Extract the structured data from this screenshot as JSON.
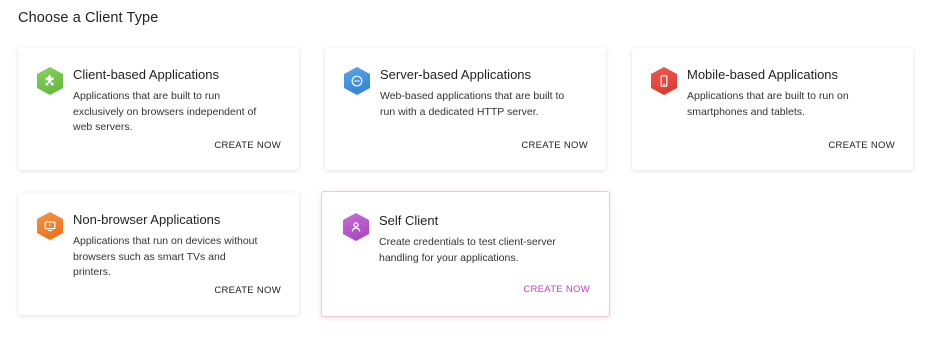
{
  "page": {
    "title": "Choose a Client Type"
  },
  "cards": [
    {
      "title": "Client-based Applications",
      "description": "Applications that are built to run exclusively on browsers independent of web servers.",
      "cta": "CREATE NOW",
      "icon": "puzzle-icon",
      "color": "#6cc24a"
    },
    {
      "title": "Server-based Applications",
      "description": "Web-based applications that are built to run with a dedicated HTTP server.",
      "cta": "CREATE NOW",
      "icon": "globe-icon",
      "color": "#3b8fd9"
    },
    {
      "title": "Mobile-based Applications",
      "description": "Applications that are built to run on smartphones and tablets.",
      "cta": "CREATE NOW",
      "icon": "mobile-phone-icon",
      "color": "#e8433a"
    },
    {
      "title": "Non-browser Applications",
      "description": "Applications that run on devices without browsers such as smart TVs and printers.",
      "cta": "CREATE NOW",
      "icon": "tv-icon",
      "color": "#f07c2a"
    },
    {
      "title": "Self Client",
      "description": "Create credentials to test client-server handling for your applications.",
      "cta": "CREATE NOW",
      "icon": "user-icon",
      "color": "#b455c8",
      "cta_color": "#c043c8",
      "selected": true
    }
  ]
}
